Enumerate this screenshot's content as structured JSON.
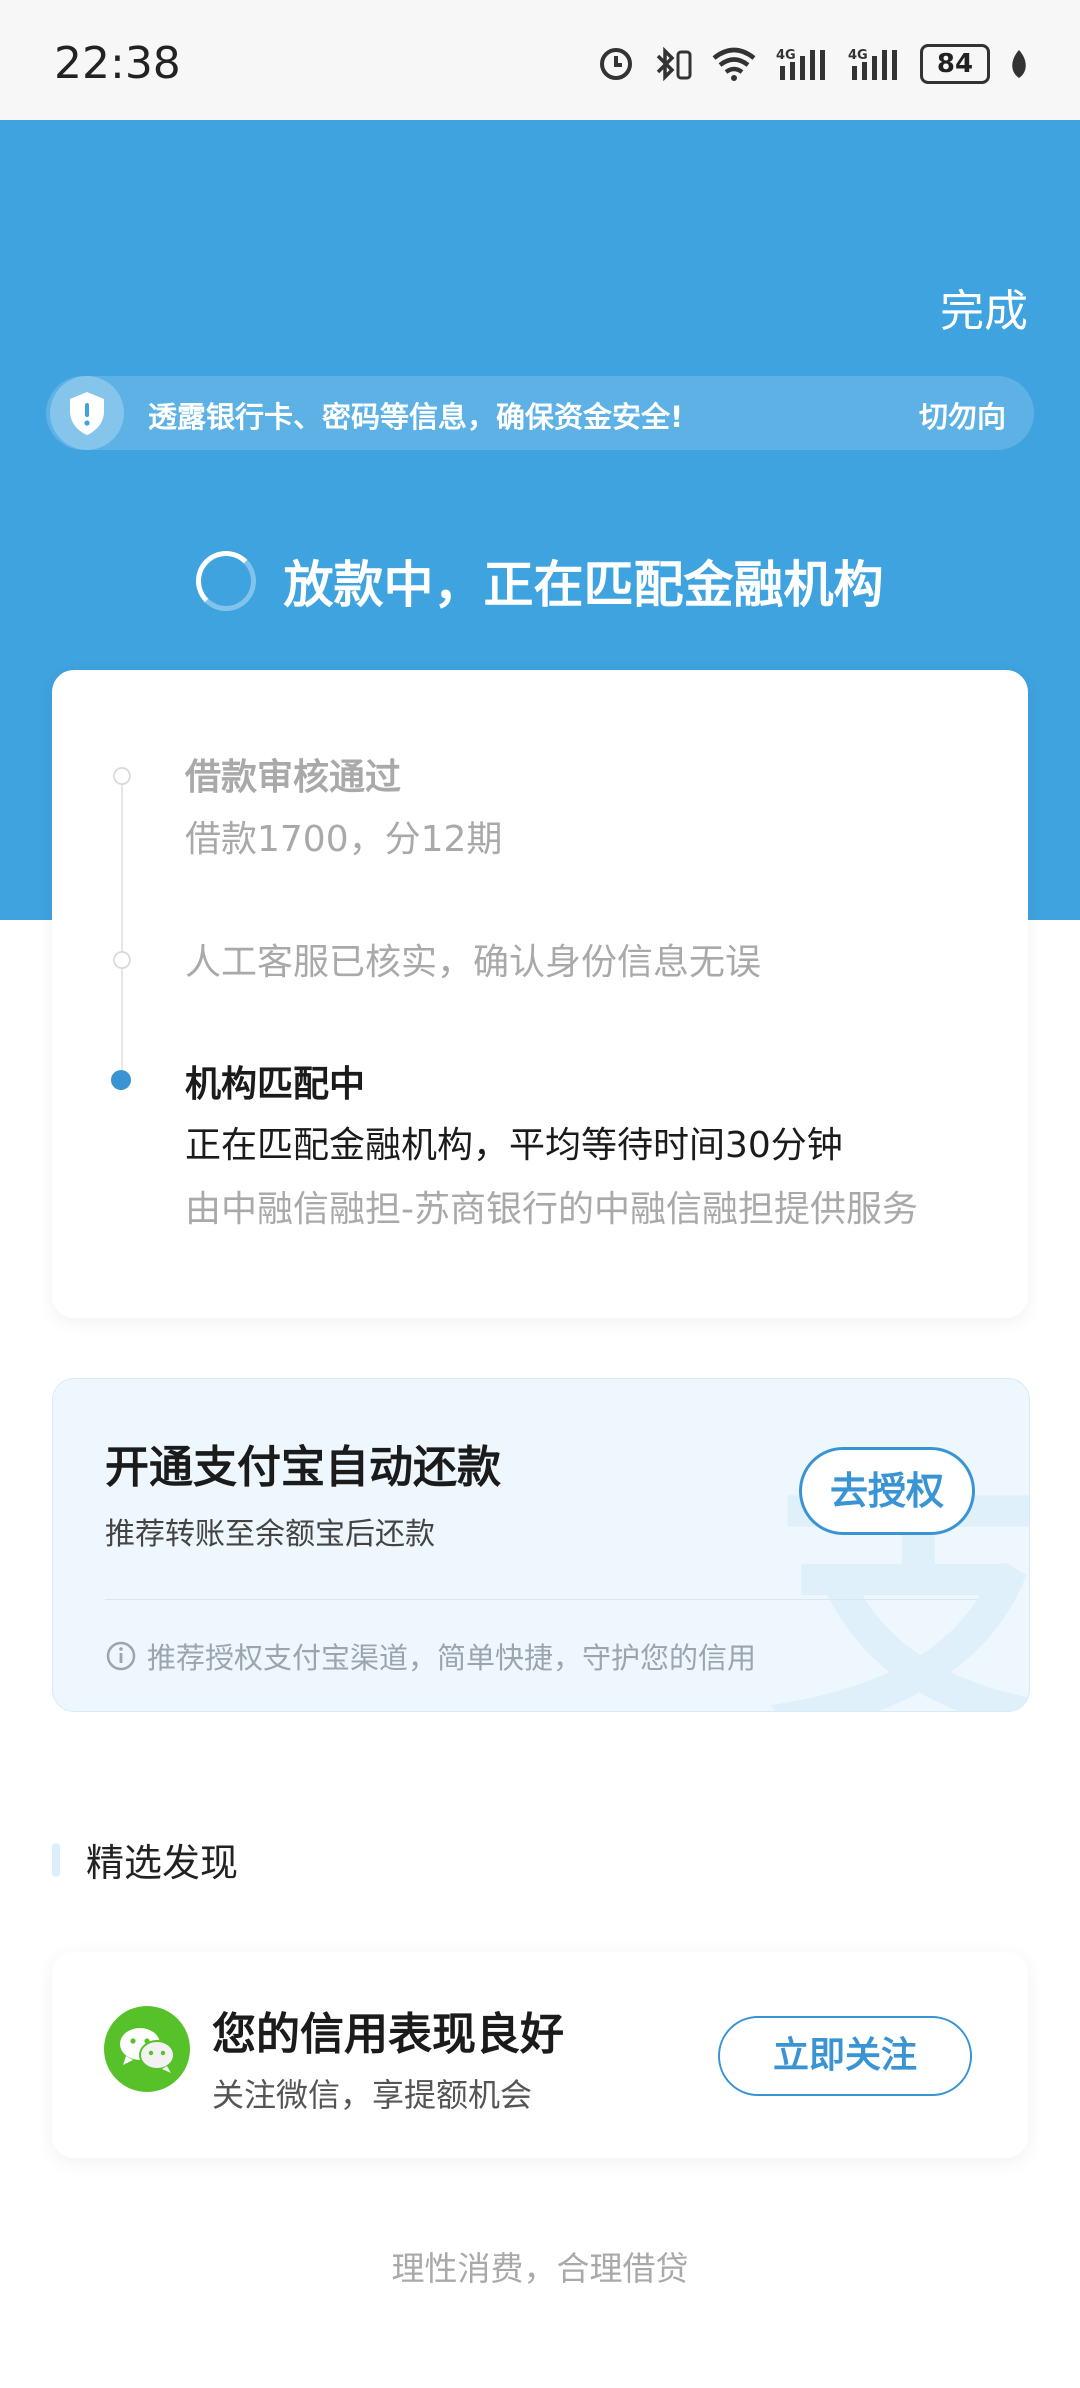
{
  "status_bar": {
    "time": "22:38",
    "battery": "84"
  },
  "header": {
    "done_label": "完成",
    "notice_text": "透露银行卡、密码等信息，确保资金安全!",
    "notice_suffix": "切勿向",
    "status_title": "放款中，正在匹配金融机构"
  },
  "timeline": {
    "steps": [
      {
        "title": "借款审核通过",
        "detail": "借款1700，分12期"
      },
      {
        "title": "人工客服已核实，确认身份信息无误"
      },
      {
        "title": "机构匹配中",
        "detail": "正在匹配金融机构，平均等待时间30分钟",
        "note": "由中融信融担-苏商银行的中融信融担提供服务"
      }
    ]
  },
  "alipay_card": {
    "title": "开通支付宝自动还款",
    "subtitle": "推荐转账至余额宝后还款",
    "button_label": "去授权",
    "tip": "推荐授权支付宝渠道，简单快捷，守护您的信用",
    "watermark": "支"
  },
  "discover": {
    "section_title": "精选发现",
    "card": {
      "title": "您的信用表现良好",
      "subtitle": "关注微信，享提额机会",
      "button_label": "立即关注"
    }
  },
  "footer": {
    "text": "理性消费，合理借贷"
  },
  "colors": {
    "primary": "#3fa3e0",
    "accent": "#3a94d4",
    "wechat": "#57c12a"
  }
}
